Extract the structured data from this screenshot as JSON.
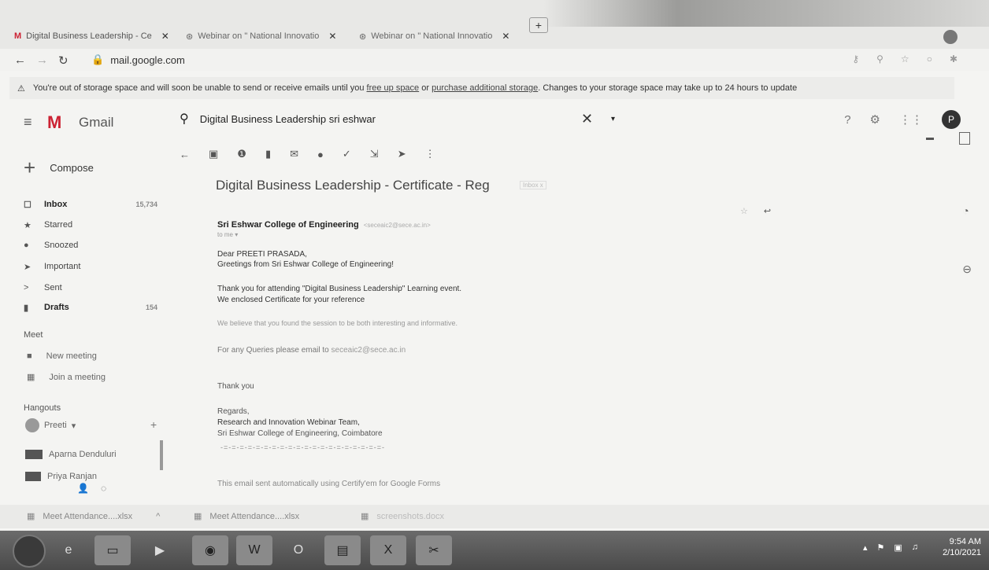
{
  "tabs": [
    {
      "label": "Digital Business Leadership - Ce",
      "active": true
    },
    {
      "label": "Webinar on \" National Innovatio",
      "active": false
    },
    {
      "label": "Webinar on \" National Innovatio",
      "active": false
    }
  ],
  "new_tab_label": "+",
  "address": {
    "url": "mail.google.com"
  },
  "warning": {
    "text1": "You're out of storage space and will soon be unable to send or receive emails until you",
    "link1": "free up space",
    "or": "or",
    "link2": "purchase additional storage",
    "text2": ". Changes to your storage space may take up to 24 hours to update"
  },
  "gmail": {
    "name": "Gmail",
    "logo": "M"
  },
  "search": {
    "query": "Digital Business Leadership sri eshwar"
  },
  "avatar_letter": "P",
  "compose_label": "Compose",
  "nav": [
    {
      "label": "Inbox",
      "count": "15,734",
      "bold": true,
      "icon": "inbox-icon",
      "glyph": "☐"
    },
    {
      "label": "Starred",
      "count": "",
      "bold": false,
      "icon": "star-icon",
      "glyph": "★"
    },
    {
      "label": "Snoozed",
      "count": "",
      "bold": false,
      "icon": "clock-icon",
      "glyph": "●"
    },
    {
      "label": "Important",
      "count": "",
      "bold": false,
      "icon": "important-icon",
      "glyph": "➤"
    },
    {
      "label": "Sent",
      "count": "",
      "bold": false,
      "icon": "send-icon",
      "glyph": ">"
    },
    {
      "label": "Drafts",
      "count": "154",
      "bold": true,
      "icon": "draft-icon",
      "glyph": "▮"
    }
  ],
  "meet": {
    "heading": "Meet",
    "new_meeting": "New meeting",
    "join": "Join a meeting"
  },
  "hangouts": {
    "heading": "Hangouts",
    "self": "Preeti",
    "contacts": [
      "Aparna Denduluri",
      "Priya Ranjan"
    ]
  },
  "email": {
    "subject": "Digital Business Leadership - Certificate - Reg",
    "label_badge": "Inbox x",
    "sender_name": "Sri Eshwar College of Engineering",
    "sender_email": "<seceaic2@sece.ac.in>",
    "to": "to me",
    "greeting": "Dear PREETI PRASADA,",
    "line1": "Greetings from Sri Eshwar College of Engineering!",
    "line2": "Thank you for attending \"Digital Business Leadership\" Learning event.",
    "line3": "We enclosed Certificate for your reference",
    "line4": "We believe that you found the session to be both interesting and informative.",
    "line5_prefix": "For any Queries please email to",
    "line5_email": "seceaic2@sece.ac.in",
    "thanks": "Thank you",
    "regards": "Regards,",
    "team": "Research and Innovation Webinar Team,",
    "college": "Sri Eshwar College of Engineering, Coimbatore",
    "dashes": "-=-=-=-=-=-=-=-=-=-=-=-=-=-=-=-=-=-=-=-=-",
    "footer": "This email sent automatically using Certify'em for Google Forms"
  },
  "downloads": [
    "Meet Attendance....xlsx",
    "Meet Attendance....xlsx",
    "screenshots.docx"
  ],
  "clock": {
    "time": "9:54 AM",
    "date": "2/10/2021"
  }
}
